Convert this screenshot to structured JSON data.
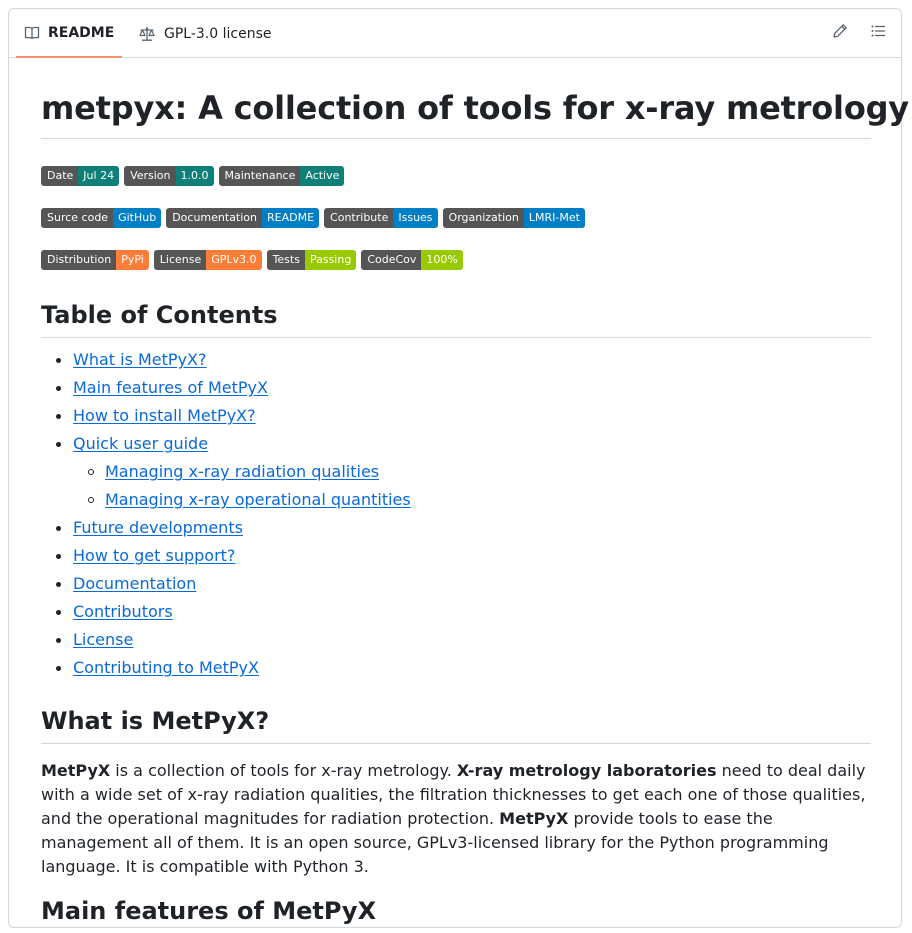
{
  "tabs": {
    "readme": "README",
    "license": "GPL-3.0 license"
  },
  "title": "metpyx: A collection of tools for x-ray metrology",
  "badges": {
    "row1": [
      {
        "label": "Date",
        "value": "Jul 24",
        "color": "#0f8077"
      },
      {
        "label": "Version",
        "value": "1.0.0",
        "color": "#0f8077"
      },
      {
        "label": "Maintenance",
        "value": "Active",
        "color": "#0f8077"
      }
    ],
    "row2": [
      {
        "label": "Surce code",
        "value": "GitHub",
        "color": "#007ec6"
      },
      {
        "label": "Documentation",
        "value": "README",
        "color": "#007ec6"
      },
      {
        "label": "Contribute",
        "value": "Issues",
        "color": "#007ec6"
      },
      {
        "label": "Organization",
        "value": "LMRI-Met",
        "color": "#007ec6"
      }
    ],
    "row3": [
      {
        "label": "Distribution",
        "value": "PyPi",
        "color": "#fe7d37"
      },
      {
        "label": "License",
        "value": "GPLv3.0",
        "color": "#fe7d37"
      },
      {
        "label": "Tests",
        "value": "Passing",
        "color": "#97ca00"
      },
      {
        "label": "CodeCov",
        "value": "100%",
        "color": "#97ca00"
      }
    ]
  },
  "toc_heading": "Table of Contents",
  "toc": [
    {
      "text": "What is MetPyX?",
      "sub": false
    },
    {
      "text": "Main features of MetPyX",
      "sub": false
    },
    {
      "text": "How to install MetPyX?",
      "sub": false
    },
    {
      "text": "Quick user guide",
      "sub": false
    },
    {
      "text": "Managing x-ray radiation qualities",
      "sub": true
    },
    {
      "text": "Managing x-ray operational quantities",
      "sub": true
    },
    {
      "text": "Future developments",
      "sub": false
    },
    {
      "text": "How to get support?",
      "sub": false
    },
    {
      "text": "Documentation",
      "sub": false
    },
    {
      "text": "Contributors",
      "sub": false
    },
    {
      "text": "License",
      "sub": false
    },
    {
      "text": "Contributing to MetPyX",
      "sub": false
    }
  ],
  "section1_heading": "What is MetPyX?",
  "section1_body": {
    "b1": "MetPyX",
    "t1": " is a collection of tools for x-ray metrology. ",
    "b2": "X-ray metrology laboratories",
    "t2": " need to deal daily with a wide set of x-ray radiation qualities, the filtration thicknesses to get each one of those qualities, and the operational magnitudes for radiation protection. ",
    "b3": "MetPyX",
    "t3": " provide tools to ease the management all of them. It is an open source, GPLv3-licensed library for the Python programming language. It is compatible with Python 3."
  },
  "section2_heading": "Main features of MetPyX"
}
